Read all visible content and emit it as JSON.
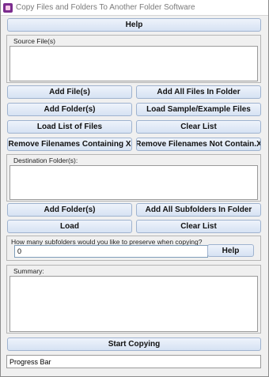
{
  "window": {
    "title": "Copy Files and Folders To Another Folder Software"
  },
  "buttons": {
    "help_top": "Help",
    "add_files": "Add File(s)",
    "add_all_files_in_folder": "Add All Files In Folder",
    "add_folders": "Add Folder(s)",
    "load_sample": "Load Sample/Example Files",
    "load_list": "Load List of Files",
    "clear_list": "Clear List",
    "remove_containing": "Remove Filenames Containing X",
    "remove_not_containing": "Remove Filenames Not Contain.X",
    "dest_add_folders": "Add Folder(s)",
    "dest_add_all_subfolders": "Add All Subfolders In Folder",
    "dest_load": "Load",
    "dest_clear_list": "Clear List",
    "subfolders_help": "Help",
    "start_copying": "Start Copying"
  },
  "source": {
    "label": "Source File(s)"
  },
  "destination": {
    "label": "Destination Folder(s):"
  },
  "subfolders": {
    "label": "How many subfolders would you like to preserve when copying?",
    "value": "0"
  },
  "summary": {
    "label": "Summary:"
  },
  "progress": {
    "label": "Progress Bar"
  }
}
